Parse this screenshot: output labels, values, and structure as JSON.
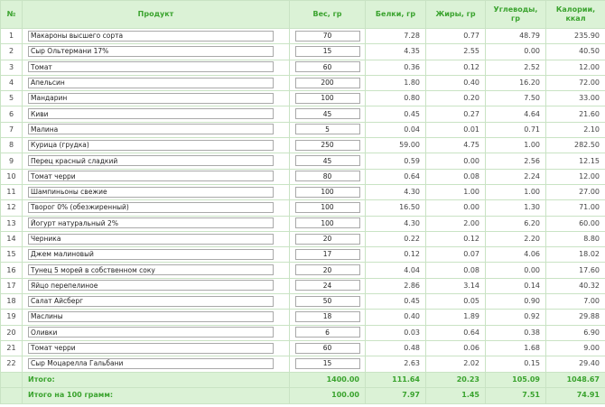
{
  "colors": {
    "header_bg": "#dbf2d6",
    "header_text": "#3aa32e",
    "border": "#c9e3c4"
  },
  "headers": {
    "num": "№",
    "product": "Продукт",
    "weight": "Вес, гр",
    "protein": "Белки, гр",
    "fat": "Жиры, гр",
    "carbs": "Углеводы, гр",
    "kcal": "Калории, ккал"
  },
  "rows": [
    {
      "n": "1",
      "product": "Макароны высшего сорта",
      "weight": "70",
      "protein": "7.28",
      "fat": "0.77",
      "carbs": "48.79",
      "kcal": "235.90"
    },
    {
      "n": "2",
      "product": "Сыр Ольтермани 17%",
      "weight": "15",
      "protein": "4.35",
      "fat": "2.55",
      "carbs": "0.00",
      "kcal": "40.50"
    },
    {
      "n": "3",
      "product": "Томат",
      "weight": "60",
      "protein": "0.36",
      "fat": "0.12",
      "carbs": "2.52",
      "kcal": "12.00"
    },
    {
      "n": "4",
      "product": "Апельсин",
      "weight": "200",
      "protein": "1.80",
      "fat": "0.40",
      "carbs": "16.20",
      "kcal": "72.00"
    },
    {
      "n": "5",
      "product": "Мандарин",
      "weight": "100",
      "protein": "0.80",
      "fat": "0.20",
      "carbs": "7.50",
      "kcal": "33.00"
    },
    {
      "n": "6",
      "product": "Киви",
      "weight": "45",
      "protein": "0.45",
      "fat": "0.27",
      "carbs": "4.64",
      "kcal": "21.60"
    },
    {
      "n": "7",
      "product": "Малина",
      "weight": "5",
      "protein": "0.04",
      "fat": "0.01",
      "carbs": "0.71",
      "kcal": "2.10"
    },
    {
      "n": "8",
      "product": "Курица (грудка)",
      "weight": "250",
      "protein": "59.00",
      "fat": "4.75",
      "carbs": "1.00",
      "kcal": "282.50"
    },
    {
      "n": "9",
      "product": "Перец красный сладкий",
      "weight": "45",
      "protein": "0.59",
      "fat": "0.00",
      "carbs": "2.56",
      "kcal": "12.15"
    },
    {
      "n": "10",
      "product": "Томат черри",
      "weight": "80",
      "protein": "0.64",
      "fat": "0.08",
      "carbs": "2.24",
      "kcal": "12.00"
    },
    {
      "n": "11",
      "product": "Шампиньоны свежие",
      "weight": "100",
      "protein": "4.30",
      "fat": "1.00",
      "carbs": "1.00",
      "kcal": "27.00"
    },
    {
      "n": "12",
      "product": "Творог 0% (обезжиренный)",
      "weight": "100",
      "protein": "16.50",
      "fat": "0.00",
      "carbs": "1.30",
      "kcal": "71.00"
    },
    {
      "n": "13",
      "product": "Йогурт натуральный 2%",
      "weight": "100",
      "protein": "4.30",
      "fat": "2.00",
      "carbs": "6.20",
      "kcal": "60.00"
    },
    {
      "n": "14",
      "product": "Черника",
      "weight": "20",
      "protein": "0.22",
      "fat": "0.12",
      "carbs": "2.20",
      "kcal": "8.80"
    },
    {
      "n": "15",
      "product": "Джем малиновый",
      "weight": "17",
      "protein": "0.12",
      "fat": "0.07",
      "carbs": "4.06",
      "kcal": "18.02"
    },
    {
      "n": "16",
      "product": "Тунец 5 морей в собственном соку",
      "weight": "20",
      "protein": "4.04",
      "fat": "0.08",
      "carbs": "0.00",
      "kcal": "17.60"
    },
    {
      "n": "17",
      "product": "Яйцо перепелиное",
      "weight": "24",
      "protein": "2.86",
      "fat": "3.14",
      "carbs": "0.14",
      "kcal": "40.32"
    },
    {
      "n": "18",
      "product": "Салат Айсберг",
      "weight": "50",
      "protein": "0.45",
      "fat": "0.05",
      "carbs": "0.90",
      "kcal": "7.00"
    },
    {
      "n": "19",
      "product": "Маслины",
      "weight": "18",
      "protein": "0.40",
      "fat": "1.89",
      "carbs": "0.92",
      "kcal": "29.88"
    },
    {
      "n": "20",
      "product": "Оливки",
      "weight": "6",
      "protein": "0.03",
      "fat": "0.64",
      "carbs": "0.38",
      "kcal": "6.90"
    },
    {
      "n": "21",
      "product": "Томат черри",
      "weight": "60",
      "protein": "0.48",
      "fat": "0.06",
      "carbs": "1.68",
      "kcal": "9.00"
    },
    {
      "n": "22",
      "product": "Сыр Моцарелла Гальбани",
      "weight": "15",
      "protein": "2.63",
      "fat": "2.02",
      "carbs": "0.15",
      "kcal": "29.40"
    }
  ],
  "totals": {
    "label": "Итого:",
    "weight": "1400.00",
    "protein": "111.64",
    "fat": "20.23",
    "carbs": "105.09",
    "kcal": "1048.67"
  },
  "per100": {
    "label": "Итого на 100 грамм:",
    "weight": "100.00",
    "protein": "7.97",
    "fat": "1.45",
    "carbs": "7.51",
    "kcal": "74.91"
  }
}
